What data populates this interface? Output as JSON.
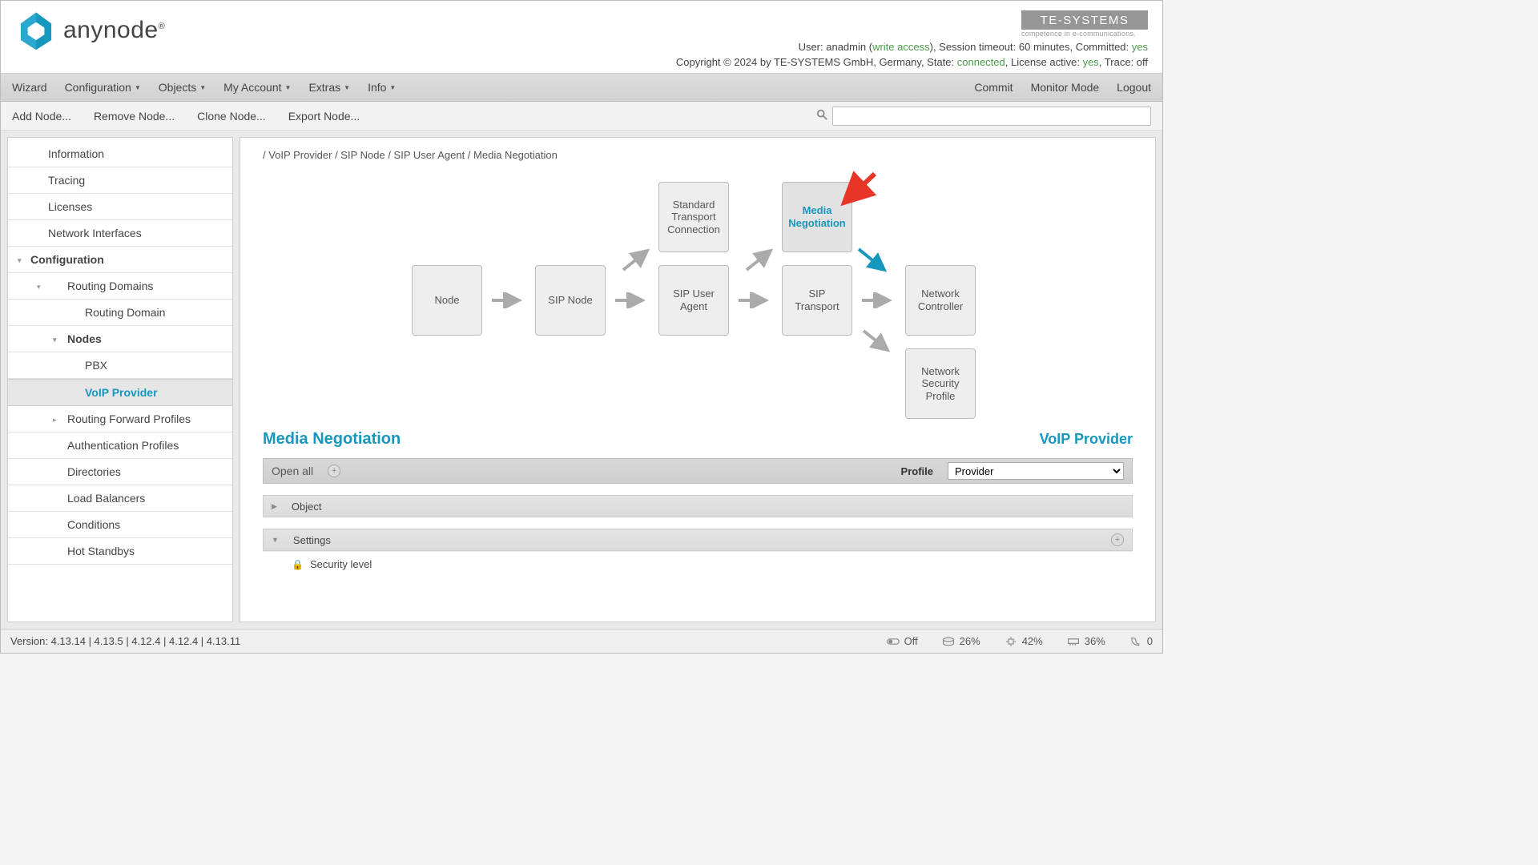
{
  "app": {
    "name": "anynode"
  },
  "vendor": {
    "name": "TE-SYSTEMS",
    "tagline": "competence in e-communications."
  },
  "status1": {
    "prefix": "User: ",
    "user": "anadmin",
    "write_access": "write access",
    "session": ", Session timeout: 60 minutes, Committed: ",
    "committed": "yes"
  },
  "status2": {
    "prefix": "Copyright © 2024 by TE-SYSTEMS GmbH, Germany, State: ",
    "state": "connected",
    "mid": ", License active: ",
    "license": "yes",
    "trace": ", Trace: off"
  },
  "menu": {
    "wizard": "Wizard",
    "configuration": "Configuration",
    "objects": "Objects",
    "my_account": "My Account",
    "extras": "Extras",
    "info": "Info",
    "commit": "Commit",
    "monitor": "Monitor Mode",
    "logout": "Logout"
  },
  "actions": {
    "add_node": "Add Node...",
    "remove_node": "Remove Node...",
    "clone_node": "Clone Node...",
    "export_node": "Export Node..."
  },
  "search": {
    "placeholder": ""
  },
  "sidebar": {
    "information": "Information",
    "tracing": "Tracing",
    "licenses": "Licenses",
    "network_interfaces": "Network Interfaces",
    "configuration": "Configuration",
    "routing_domains": "Routing Domains",
    "routing_domain": "Routing Domain",
    "nodes": "Nodes",
    "pbx": "PBX",
    "voip_provider": "VoIP Provider",
    "routing_forward": "Routing Forward Profiles",
    "auth_profiles": "Authentication Profiles",
    "directories": "Directories",
    "load_balancers": "Load Balancers",
    "conditions": "Conditions",
    "hot_standbys": "Hot Standbys"
  },
  "breadcrumb": "/ VoIP Provider / SIP Node / SIP User Agent / Media Negotiation",
  "diagram": {
    "node": "Node",
    "sip_node": "SIP Node",
    "sip_user_agent": "SIP User Agent",
    "std_transport": "Standard Transport Connection",
    "media_neg": "Media Negotiation",
    "sip_transport": "SIP Transport",
    "network_controller": "Network Controller",
    "network_security": "Network Security Profile"
  },
  "section": {
    "title": "Media Negotiation",
    "context": "VoIP Provider"
  },
  "toolbar": {
    "open_all": "Open all",
    "profile_label": "Profile",
    "profile_value": "Provider"
  },
  "panels": {
    "object": "Object",
    "settings": "Settings",
    "security_level": "Security level"
  },
  "footer": {
    "version": "Version: 4.13.14 | 4.13.5 | 4.12.4 | 4.12.4 | 4.13.11",
    "off": "Off",
    "disk": "26%",
    "cpu": "42%",
    "mem": "36%",
    "calls": "0"
  }
}
